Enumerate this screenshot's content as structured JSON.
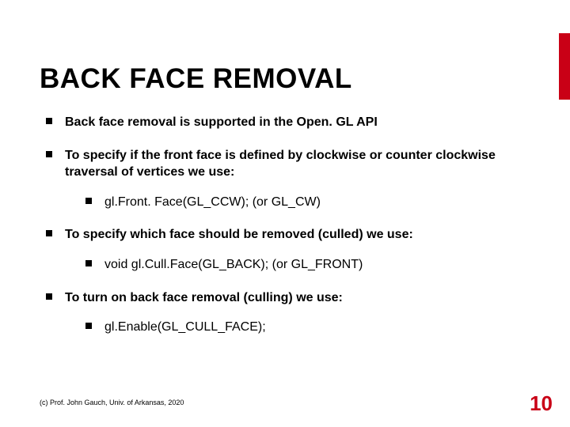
{
  "title": "BACK FACE REMOVAL",
  "bullets": [
    {
      "text": "Back face removal is supported in the Open. GL API"
    },
    {
      "text": "To specify if the front face is defined by clockwise or counter clockwise traversal of vertices we use:",
      "sub": [
        "gl.Front. Face(GL_CCW);  (or GL_CW)"
      ]
    },
    {
      "text": "To specify which face should be removed (culled) we use:",
      "sub": [
        "void gl.Cull.Face(GL_BACK); (or GL_FRONT)"
      ]
    },
    {
      "text": "To turn on back face removal (culling) we use:",
      "sub": [
        "gl.Enable(GL_CULL_FACE);"
      ]
    }
  ],
  "footer": "(c) Prof. John Gauch, Univ. of Arkansas, 2020",
  "page_number": "10"
}
